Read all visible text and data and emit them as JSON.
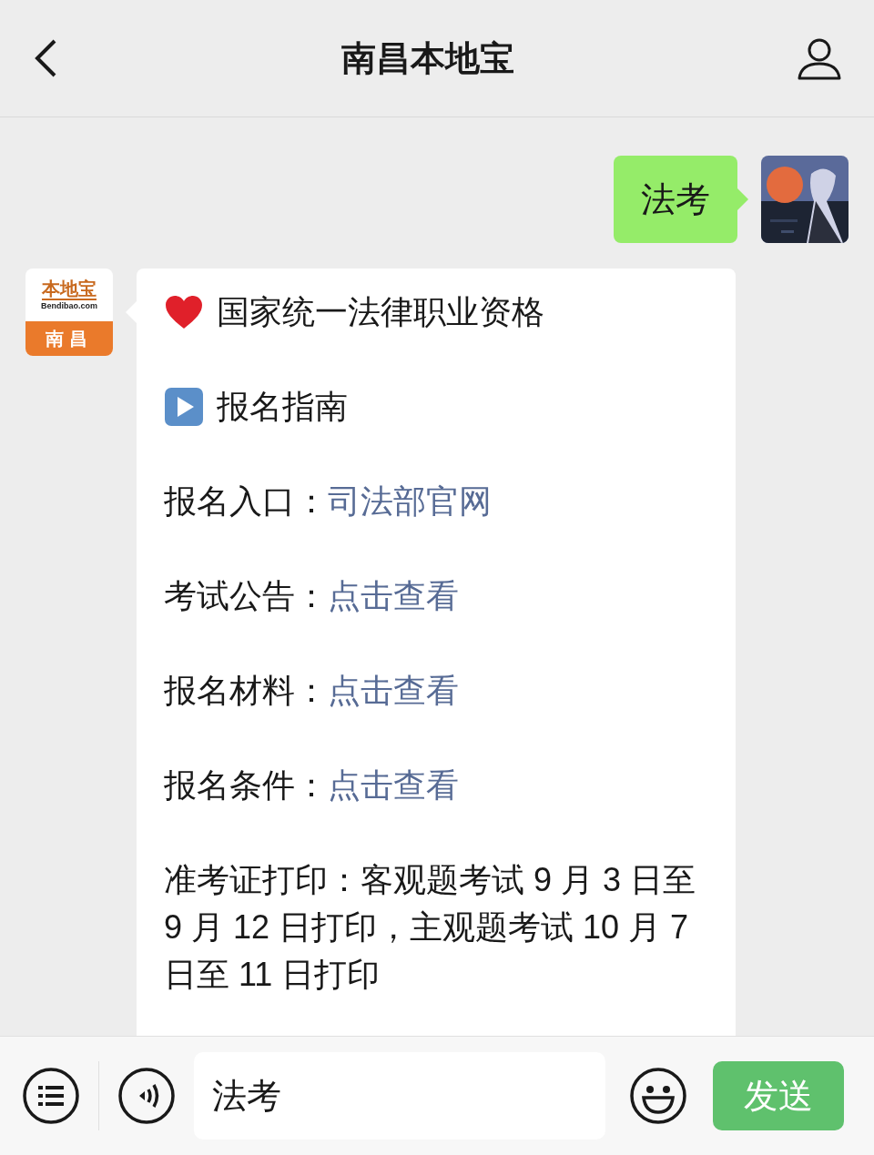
{
  "header": {
    "title": "南昌本地宝"
  },
  "messages": [
    {
      "kind": "sent",
      "text": "法考"
    },
    {
      "kind": "received",
      "avatar": {
        "logo_name": "本地宝",
        "logo_domain": "Bendibao.com",
        "logo_city": "南昌"
      },
      "lines": [
        {
          "kind": "heart",
          "text": "国家统一法律职业资格"
        },
        {
          "kind": "play",
          "text": "报名指南"
        },
        {
          "kind": "link",
          "label": "报名入口：",
          "link": "司法部官网"
        },
        {
          "kind": "link",
          "label": "考试公告：",
          "link": "点击查看"
        },
        {
          "kind": "link",
          "label": "报名材料：",
          "link": "点击查看"
        },
        {
          "kind": "link",
          "label": "报名条件：",
          "link": "点击查看"
        },
        {
          "kind": "text",
          "text": "准考证打印：客观题考试 9 月 3 日至 9 月 12 日打印，主观题考试 10 月 7 日至 11 日打印"
        }
      ]
    }
  ],
  "input": {
    "value": "法考"
  },
  "send_button": "发送"
}
